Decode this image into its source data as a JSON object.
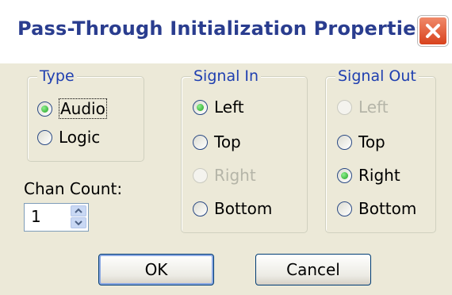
{
  "window": {
    "title": "Pass-Through Initialization Properties"
  },
  "type_group": {
    "legend": "Type",
    "options": [
      {
        "label": "Audio",
        "selected": true,
        "enabled": true
      },
      {
        "label": "Logic",
        "selected": false,
        "enabled": true
      }
    ]
  },
  "chan_count": {
    "label": "Chan Count:",
    "value": "1"
  },
  "signal_in": {
    "legend": "Signal In",
    "options": [
      {
        "label": "Left",
        "selected": true,
        "enabled": true
      },
      {
        "label": "Top",
        "selected": false,
        "enabled": true
      },
      {
        "label": "Right",
        "selected": false,
        "enabled": false
      },
      {
        "label": "Bottom",
        "selected": false,
        "enabled": true
      }
    ]
  },
  "signal_out": {
    "legend": "Signal Out",
    "options": [
      {
        "label": "Left",
        "selected": false,
        "enabled": false
      },
      {
        "label": "Top",
        "selected": false,
        "enabled": true
      },
      {
        "label": "Right",
        "selected": true,
        "enabled": true
      },
      {
        "label": "Bottom",
        "selected": false,
        "enabled": true
      }
    ]
  },
  "buttons": {
    "ok": "OK",
    "cancel": "Cancel"
  },
  "colors": {
    "accent": "#1f3fb0",
    "title": "#2a3d8f",
    "close": "#d8421d",
    "selected_dot": "#21a121"
  }
}
